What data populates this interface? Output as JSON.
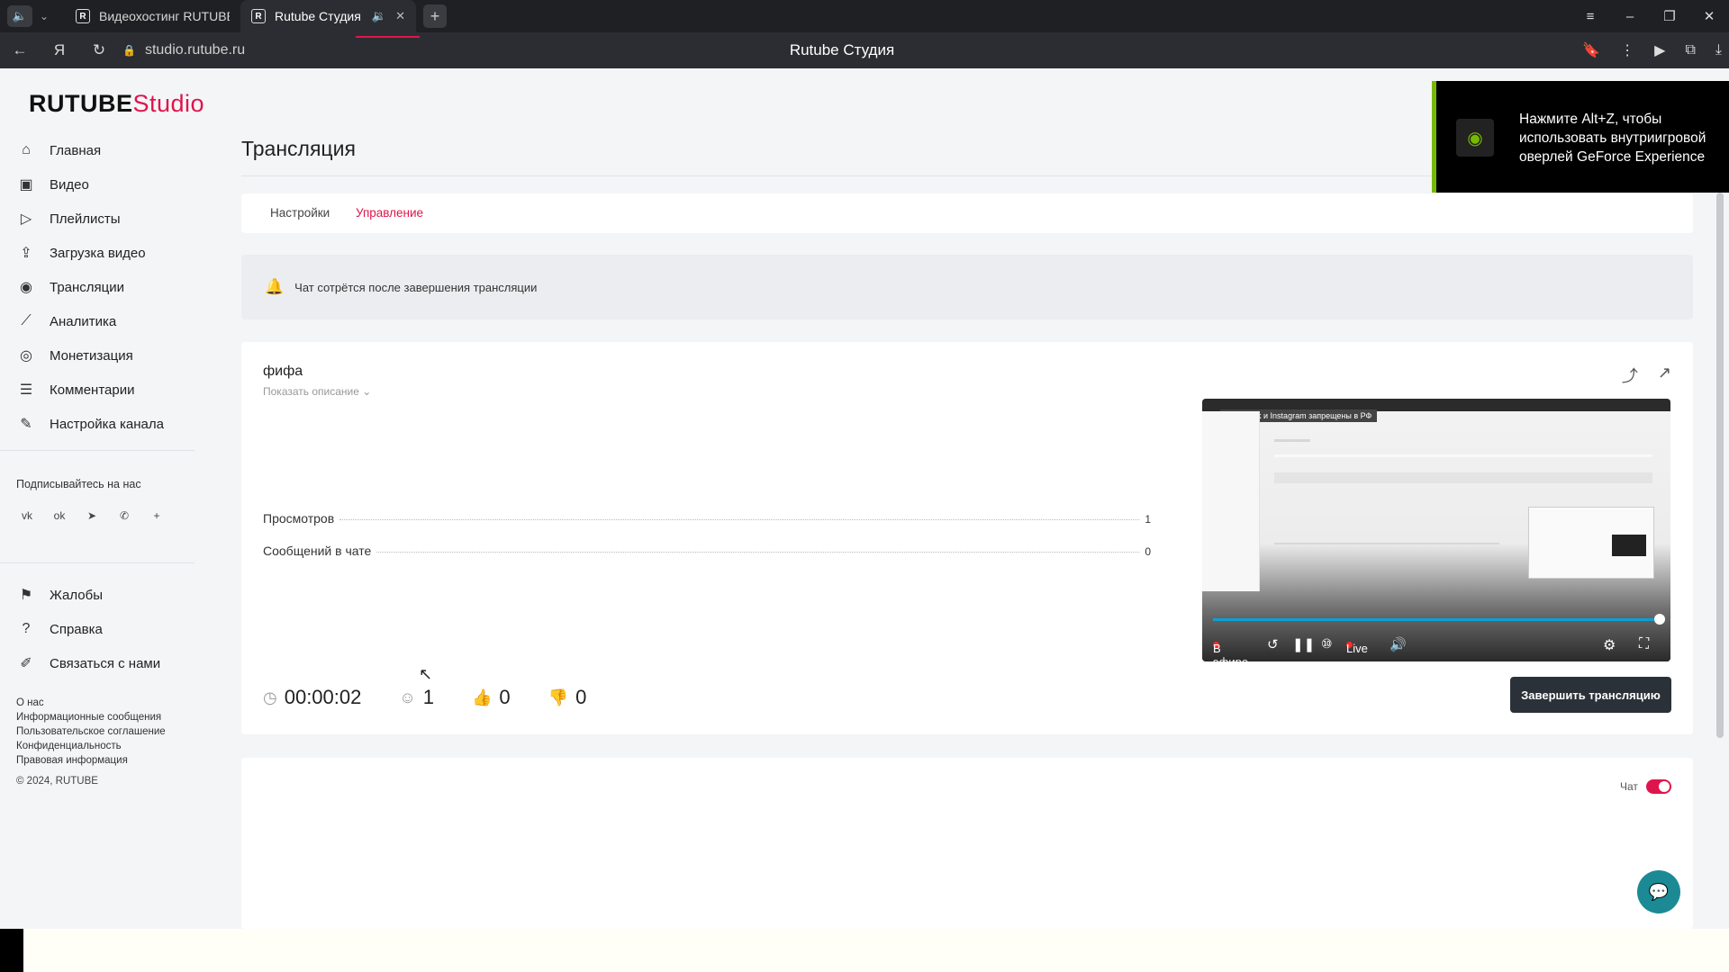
{
  "browser": {
    "tabs": [
      {
        "label": "Видеохостинг RUTUBE. С",
        "favicon": "R"
      },
      {
        "label": "Rutube Студия",
        "favicon": "R"
      }
    ],
    "url": "studio.rutube.ru",
    "page_title": "Rutube Студия"
  },
  "logo": {
    "part1": "RUTUBE",
    "part2": "Studio"
  },
  "sidebar": {
    "items": [
      {
        "label": "Главная",
        "icon": "home-icon",
        "glyph": "⌂"
      },
      {
        "label": "Видео",
        "icon": "video-icon",
        "glyph": "▣"
      },
      {
        "label": "Плейлисты",
        "icon": "playlist-icon",
        "glyph": "▷"
      },
      {
        "label": "Загрузка видео",
        "icon": "upload-icon",
        "glyph": "⇪"
      },
      {
        "label": "Трансляции",
        "icon": "broadcast-icon",
        "glyph": "◉"
      },
      {
        "label": "Аналитика",
        "icon": "analytics-icon",
        "glyph": "⟋"
      },
      {
        "label": "Монетизация",
        "icon": "monetization-icon",
        "glyph": "◎"
      },
      {
        "label": "Комментарии",
        "icon": "comments-icon",
        "glyph": "☰"
      },
      {
        "label": "Настройка канала",
        "icon": "channel-settings-icon",
        "glyph": "✎"
      }
    ],
    "subscribe_label": "Подписывайтесь на нас",
    "socials": [
      "vk-icon",
      "ok-icon",
      "telegram-icon",
      "viber-icon",
      "more-icon"
    ],
    "social_glyphs": [
      "vk",
      "ok",
      "➤",
      "✆",
      "+"
    ],
    "support_items": [
      {
        "label": "Жалобы",
        "icon": "flag-icon",
        "glyph": "⚑"
      },
      {
        "label": "Справка",
        "icon": "help-icon",
        "glyph": "?"
      },
      {
        "label": "Связаться с нами",
        "icon": "contact-icon",
        "glyph": "✐"
      }
    ],
    "footer_links": [
      "О нас",
      "Информационные сообщения",
      "Пользовательское соглашение",
      "Конфиденциальность",
      "Правовая информация"
    ],
    "copyright": "© 2024, RUTUBE"
  },
  "main": {
    "title": "Трансляция",
    "tabs": [
      {
        "label": "Настройки",
        "active": false
      },
      {
        "label": "Управление",
        "active": true
      }
    ],
    "notice": "Чат сотрётся после завершения трансляции"
  },
  "stream": {
    "title": "фифа",
    "show_description": "Показать описание",
    "stats": [
      {
        "label": "Просмотров",
        "value": "1"
      },
      {
        "label": "Сообщений в чате",
        "value": "0"
      }
    ],
    "duration": "00:00:02",
    "viewers": "1",
    "likes": "0",
    "dislikes": "0",
    "end_button": "Завершить трансляцию"
  },
  "player": {
    "banner": "Facebook и Instagram запрещены в РФ",
    "on_air": "В эфире",
    "live": "Live",
    "progress": 1.0
  },
  "chat": {
    "label": "Чат",
    "enabled": true
  },
  "overlay": {
    "text": "Нажмите Alt+Z, чтобы использовать внутриигровой оверлей GeForce Experience"
  },
  "colors": {
    "accent": "#e0144c",
    "nvidia": "#76b900",
    "dark_button": "#2b3138",
    "fab": "#1b8a94"
  }
}
